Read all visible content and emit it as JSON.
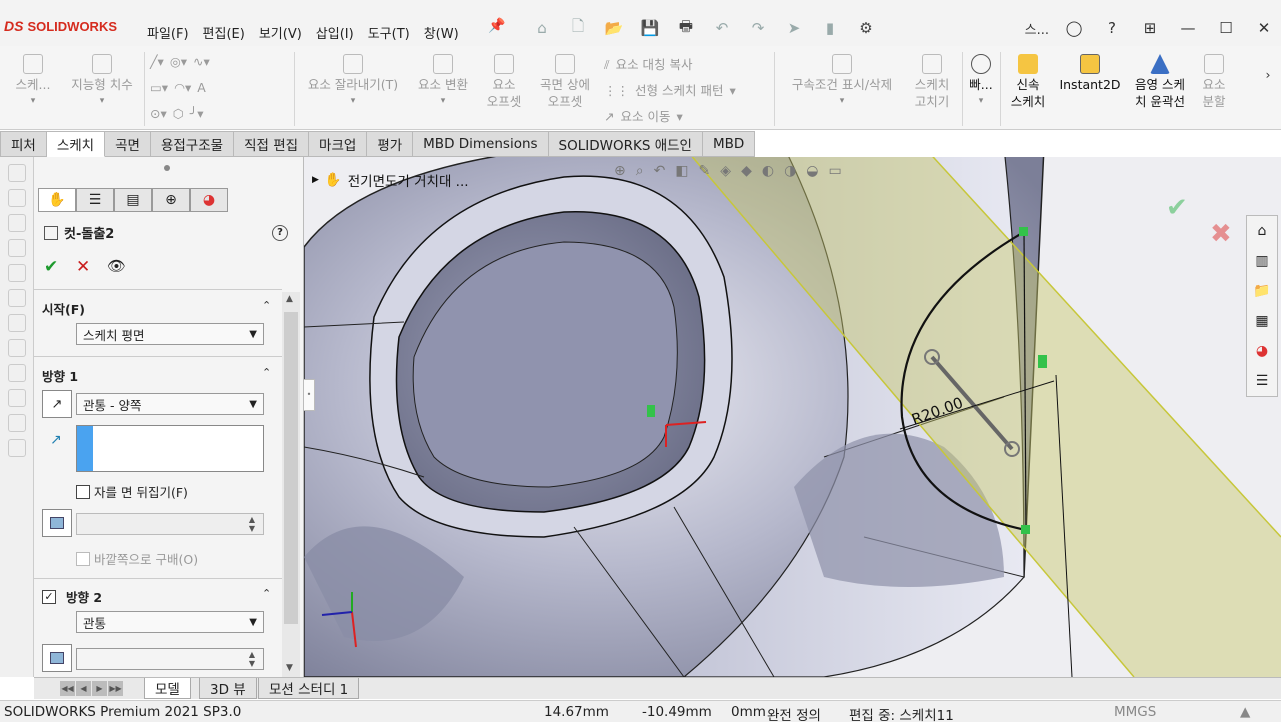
{
  "app": {
    "brand": "SOLIDWORKS",
    "brand_prefix": "DS"
  },
  "menus": [
    "파일(F)",
    "편집(E)",
    "보기(V)",
    "삽입(I)",
    "도구(T)",
    "창(W)"
  ],
  "window": {
    "search_label": "스..."
  },
  "commands": {
    "sketch": "스케...",
    "smart_dim": "지능형 치수",
    "trim": "요소 잘라내기(T)",
    "convert": "요소 변환",
    "offset_line1": "요소",
    "offset_line2": "오프셋",
    "offset_surface_line1": "곡면 상에",
    "offset_surface_line2": "오프셋",
    "mirror": "요소 대칭 복사",
    "linear_pattern": "선형 스케치 패턴",
    "move": "요소 이동",
    "relations": "구속조건 표시/삭제",
    "fix_line1": "스케치",
    "fix_line2": "고치기",
    "quick_snaps": "빠...",
    "rapid_line1": "신속",
    "rapid_line2": "스케치",
    "instant2d": "Instant2D",
    "shaded_line1": "음영 스케",
    "shaded_line2": "치 윤곽선",
    "split_line1": "요소",
    "split_line2": "분할"
  },
  "tabs": [
    "피처",
    "스케치",
    "곡면",
    "용접구조물",
    "직접 편집",
    "마크업",
    "평가",
    "MBD Dimensions",
    "SOLIDWORKS 애드인",
    "MBD"
  ],
  "pm": {
    "title": "컷-돌출2",
    "from_label": "시작(F)",
    "from_value": "스케치 평면",
    "dir1_label": "방향 1",
    "dir1_value": "관통 - 양쪽",
    "flip_label": "자를 면 뒤집기(F)",
    "draft_label": "바깥쪽으로 구배(O)",
    "dir2_label": "방향 2",
    "dir2_value": "관통"
  },
  "viewport": {
    "breadcrumb": "전기면도기 거치대 ...",
    "dimension": "R20.00"
  },
  "bottom_tabs": [
    "모델",
    "3D 뷰",
    "모션 스터디 1"
  ],
  "status": {
    "product": "SOLIDWORKS Premium 2021 SP3.0",
    "x": "14.67mm",
    "y": "-10.49mm",
    "z": "0mm",
    "state": "완전 정의",
    "editing": "편집 중: 스케치11",
    "units": "MMGS"
  },
  "colors": {
    "brand": "#d52b1e",
    "ok": "#1e9a2e",
    "cancel": "#c91d1d",
    "selection": "#4aa3f0",
    "plane": "#c8c86a"
  }
}
